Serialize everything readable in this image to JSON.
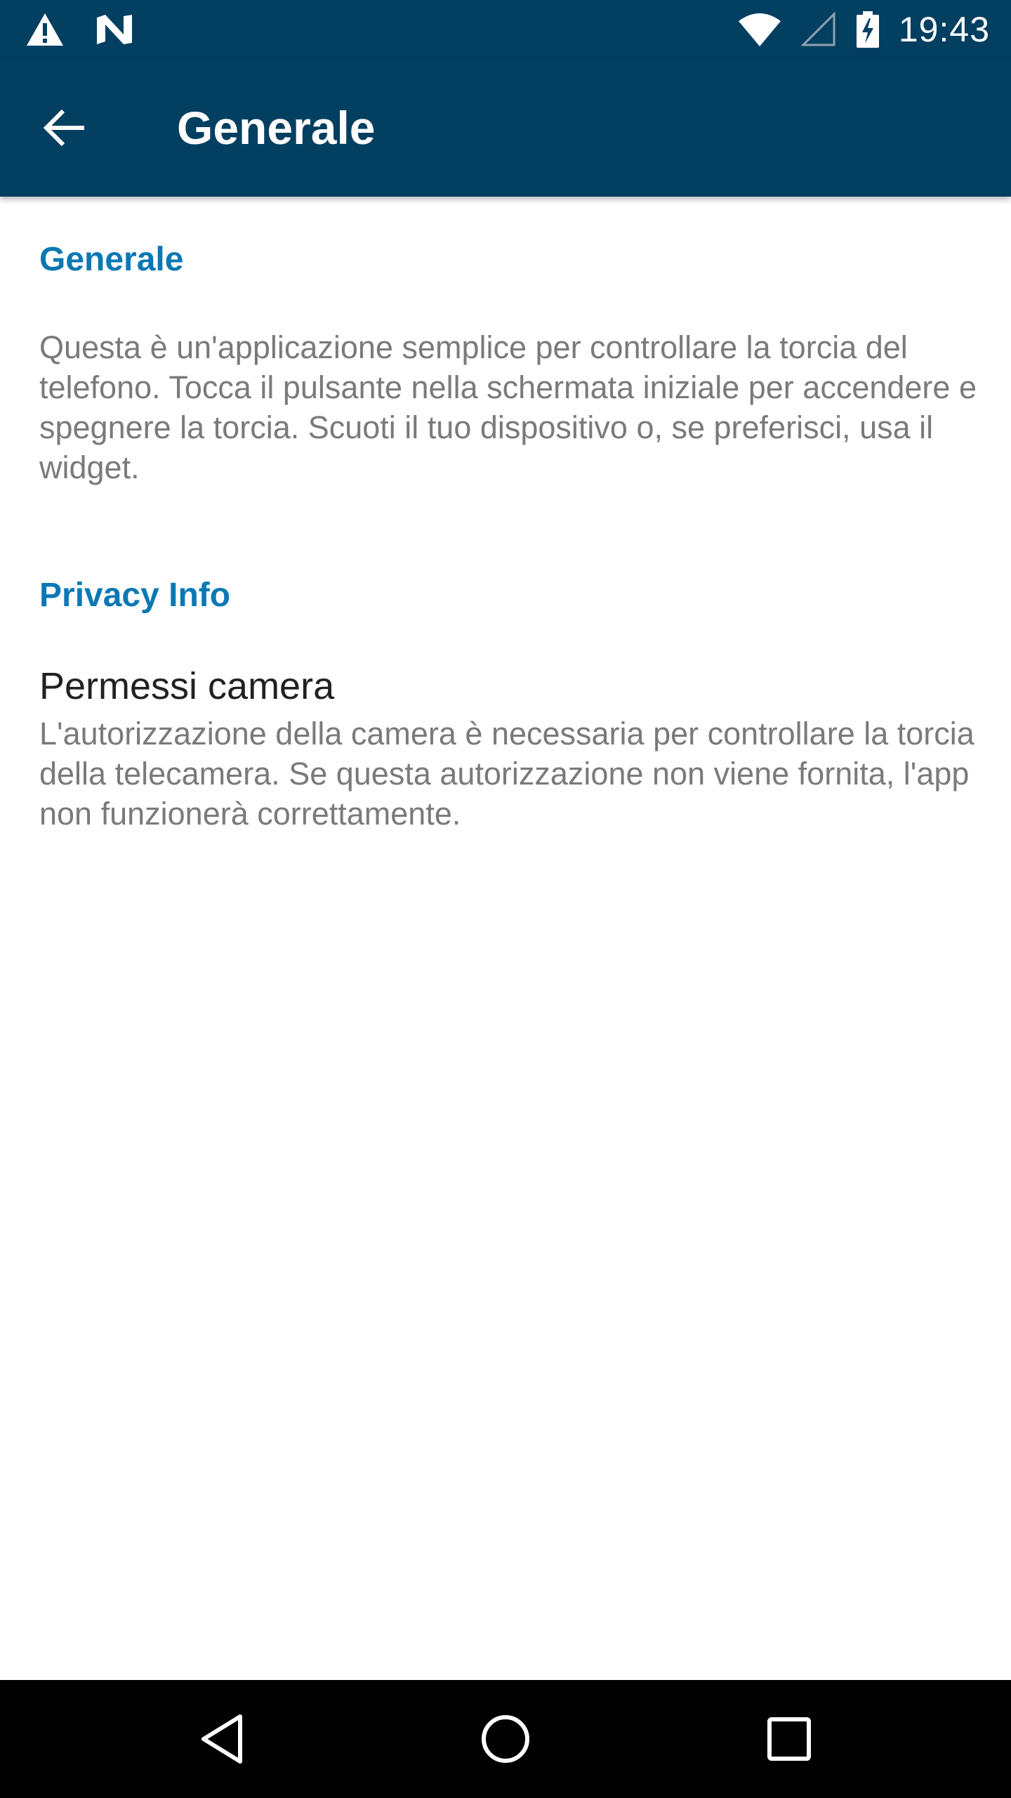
{
  "status_bar": {
    "time": "19:43",
    "left_icons": [
      "warning-icon",
      "n-notification-icon"
    ],
    "right_icons": [
      "wifi-icon",
      "cell-signal-icon",
      "battery-charging-icon"
    ]
  },
  "app_bar": {
    "title": "Generale",
    "back_icon": "arrow-back-icon"
  },
  "sections": {
    "general": {
      "header": "Generale",
      "text": "Questa è un'applicazione semplice per controllare la torcia del telefono. Tocca il pulsante nella schermata iniziale per accendere e spegnere la torcia. Scuoti il tuo dispositivo o, se preferisci, usa il widget."
    },
    "privacy": {
      "header": "Privacy Info",
      "items": [
        {
          "title": "Permessi camera",
          "summary": "L'autorizzazione della camera è necessaria per controllare la torcia della telecamera. Se questa autorizzazione non viene fornita, l'app non funzionerà correttamente."
        }
      ]
    }
  },
  "nav_bar": {
    "icons": [
      "back-triangle-icon",
      "home-circle-icon",
      "recents-square-icon"
    ]
  },
  "colors": {
    "primary_dark": "#023f61",
    "accent": "#0b78b4",
    "secondary_text": "#7a7a7a",
    "primary_text": "#212121"
  }
}
